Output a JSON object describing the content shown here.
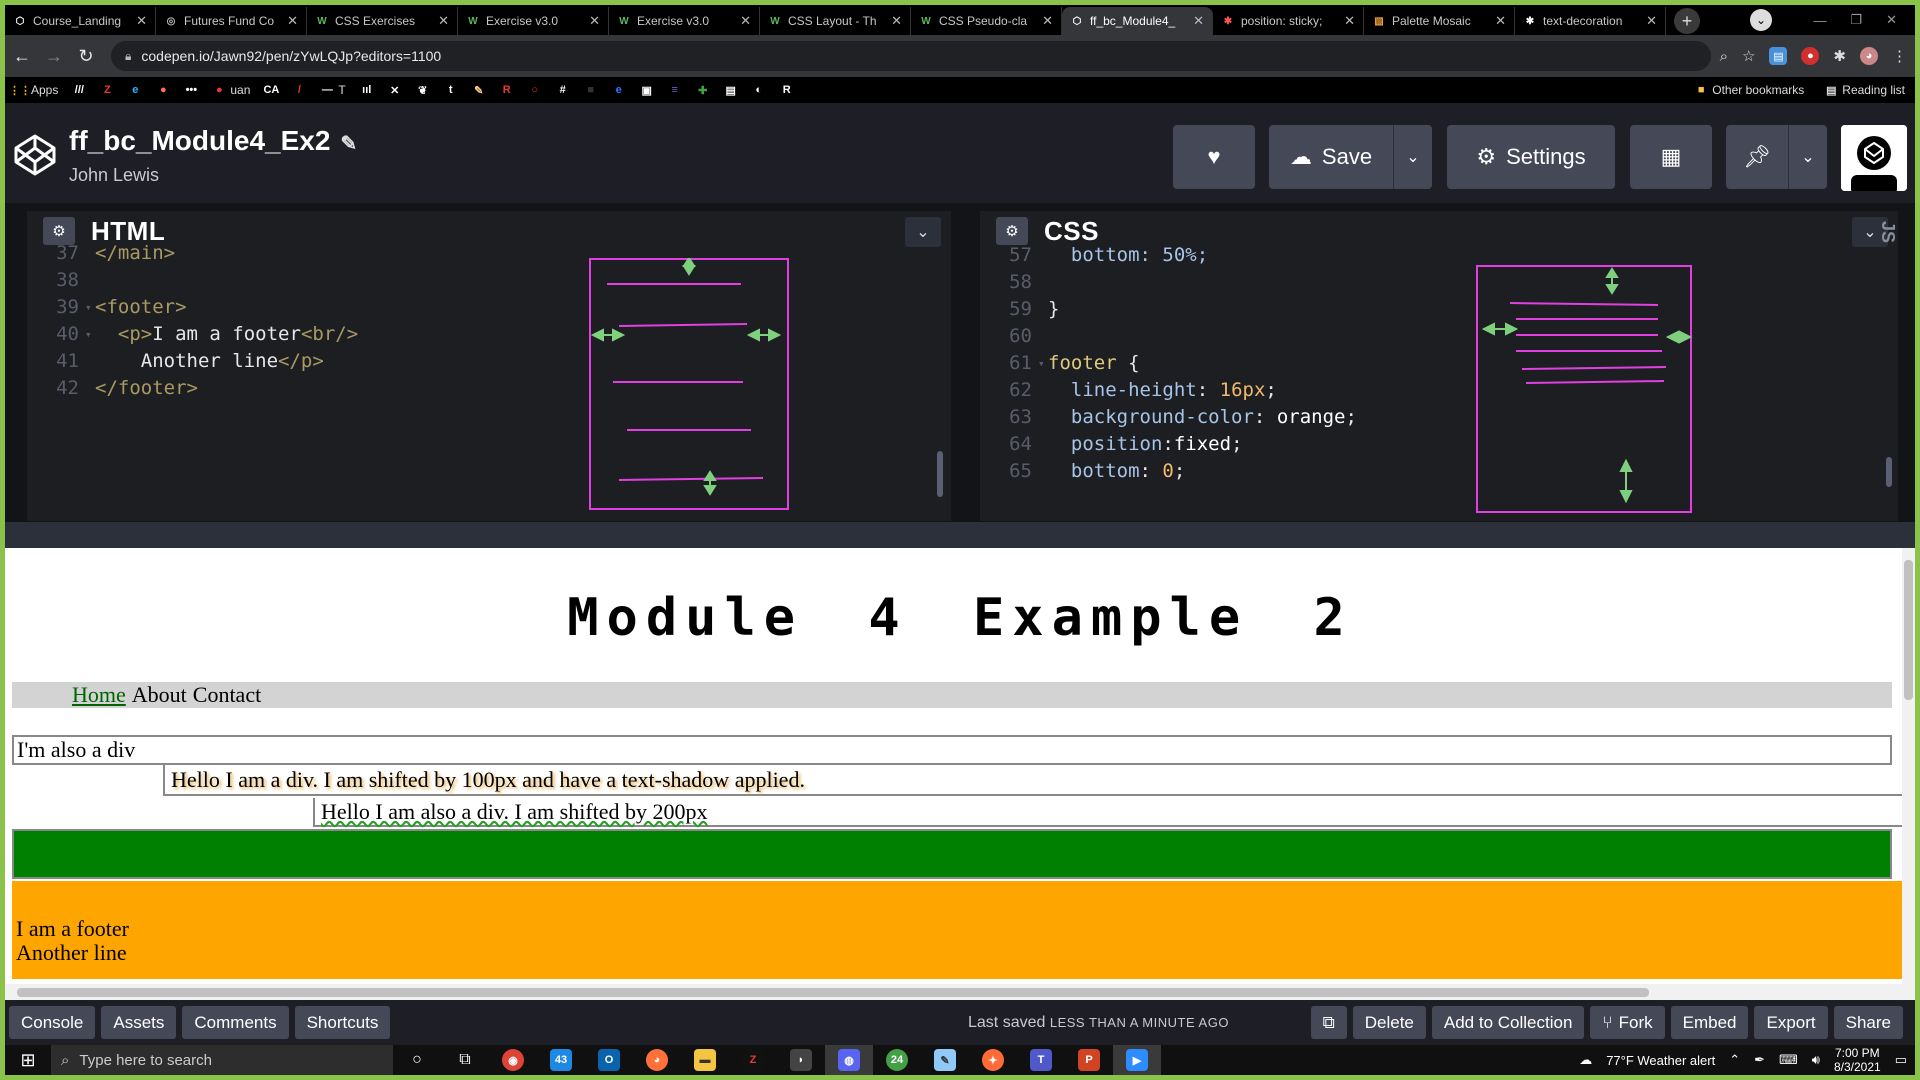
{
  "browser": {
    "tabs": [
      {
        "title": "Course_Landing",
        "favicon": "codepen-icon",
        "color": "#ffffff",
        "active": false
      },
      {
        "title": "Futures Fund Co",
        "favicon": "globe-icon",
        "color": "#bbbbbb",
        "active": false
      },
      {
        "title": "CSS Exercises",
        "favicon": "w-icon",
        "color": "#5cb85c",
        "active": false
      },
      {
        "title": "Exercise v3.0",
        "favicon": "w-icon",
        "color": "#5cb85c",
        "active": false
      },
      {
        "title": "Exercise v3.0",
        "favicon": "w-icon",
        "color": "#5cb85c",
        "active": false
      },
      {
        "title": "CSS Layout - Th",
        "favicon": "w-icon",
        "color": "#5cb85c",
        "active": false
      },
      {
        "title": "CSS Pseudo-cla",
        "favicon": "w-icon",
        "color": "#5cb85c",
        "active": false
      },
      {
        "title": "ff_bc_Module4_",
        "favicon": "codepen-icon",
        "color": "#ffffff",
        "active": true
      },
      {
        "title": "position: sticky;",
        "favicon": "mdn-icon",
        "color": "#ff5555",
        "active": false
      },
      {
        "title": "Palette Mosaic",
        "favicon": "palette-icon",
        "color": "#f0a030",
        "active": false
      },
      {
        "title": "text-decoration",
        "favicon": "mdn-icon",
        "color": "#ffffff",
        "active": false
      }
    ],
    "new_tab": "+",
    "url": "codepen.io/Jawn92/pen/zYwLQJp?editors=1100",
    "bookmarks": [
      {
        "label": "Apps",
        "icon": "apps-grid-icon",
        "color": "#f4b400"
      },
      {
        "label": "",
        "icon": "slash-icon",
        "color": "#ffffff",
        "text": "///"
      },
      {
        "label": "",
        "icon": "z-icon",
        "color": "#e53935",
        "text": "Z"
      },
      {
        "label": "",
        "icon": "e-icon",
        "color": "#29b6f6",
        "text": "e"
      },
      {
        "label": "",
        "icon": "orange-circle-icon",
        "color": "#ff7043",
        "text": "●"
      },
      {
        "label": "",
        "icon": "dots-icon",
        "color": "#ffffff",
        "text": "•••"
      },
      {
        "label": "uan",
        "icon": "red-circle-icon",
        "color": "#e53935",
        "text": "●"
      },
      {
        "label": "",
        "icon": "ca-icon",
        "color": "#ffffff",
        "text": "CA"
      },
      {
        "label": "",
        "icon": "slash-red-icon",
        "color": "#e53935",
        "text": "/"
      },
      {
        "label": "T",
        "icon": "dash-icon",
        "color": "#ffffff",
        "text": "—"
      },
      {
        "label": "",
        "icon": "bars-icon",
        "color": "#ffffff",
        "text": "ııl"
      },
      {
        "label": "",
        "icon": "x-box-icon",
        "color": "#ffffff",
        "text": "✕"
      },
      {
        "label": "",
        "icon": "leaf-icon",
        "color": "#ffffff",
        "text": "❦"
      },
      {
        "label": "",
        "icon": "t-icon",
        "color": "#ffffff",
        "text": "t"
      },
      {
        "label": "",
        "icon": "feather-icon",
        "color": "#ffcc80",
        "text": "✎"
      },
      {
        "label": "",
        "icon": "r-icon",
        "color": "#e53935",
        "text": "R"
      },
      {
        "label": "",
        "icon": "ring-icon",
        "color": "#e53935",
        "text": "○"
      },
      {
        "label": "",
        "icon": "hash-icon",
        "color": "#ffffff",
        "text": "#"
      },
      {
        "label": "",
        "icon": "dark-square-icon",
        "color": "#333333",
        "text": "■"
      },
      {
        "label": "",
        "icon": "e-blue-icon",
        "color": "#2979ff",
        "text": "e"
      },
      {
        "label": "",
        "icon": "box-icon",
        "color": "#ffffff",
        "text": "▣"
      },
      {
        "label": "",
        "icon": "list-icon",
        "color": "#7e57c2",
        "text": "≡"
      },
      {
        "label": "",
        "icon": "plus-icon",
        "color": "#43a047",
        "text": "✚"
      },
      {
        "label": "",
        "icon": "sheet-icon",
        "color": "#ffffff",
        "text": "▤"
      },
      {
        "label": "",
        "icon": "globe-icon",
        "color": "#ffffff",
        "text": "◐"
      },
      {
        "label": "",
        "icon": "r-box-icon",
        "color": "#ffffff",
        "text": "R"
      }
    ],
    "other_bookmarks": "Other bookmarks",
    "reading_list": "Reading list"
  },
  "codepen": {
    "title": "ff_bc_Module4_Ex2",
    "author": "John Lewis",
    "buttons": {
      "like": "♥",
      "save": "Save",
      "settings": "Settings"
    },
    "editors": {
      "html": {
        "name": "HTML",
        "lines": [
          {
            "n": "37",
            "fold": "",
            "indent": "",
            "parts": [
              {
                "c": "tg",
                "t": "</main>"
              }
            ]
          },
          {
            "n": "38",
            "fold": "",
            "indent": "",
            "parts": []
          },
          {
            "n": "39",
            "fold": "▾",
            "indent": "",
            "parts": [
              {
                "c": "tg",
                "t": "<footer>"
              }
            ]
          },
          {
            "n": "40",
            "fold": "▾",
            "indent": "  ",
            "parts": [
              {
                "c": "tg",
                "t": "<p>"
              },
              {
                "c": "tx",
                "t": "I am a footer"
              },
              {
                "c": "tg",
                "t": "<br/>"
              }
            ]
          },
          {
            "n": "41",
            "fold": "",
            "indent": "    ",
            "parts": [
              {
                "c": "tx",
                "t": "Another line"
              },
              {
                "c": "tg",
                "t": "</p>"
              }
            ]
          },
          {
            "n": "42",
            "fold": "",
            "indent": "",
            "parts": [
              {
                "c": "tg",
                "t": "</footer>"
              }
            ]
          }
        ]
      },
      "css": {
        "name": "CSS",
        "lines": [
          {
            "n": "57",
            "fold": "",
            "indent": "  ",
            "parts": [
              {
                "c": "prop",
                "t": "bottom: 50%;"
              }
            ]
          },
          {
            "n": "58",
            "fold": "",
            "indent": "",
            "parts": []
          },
          {
            "n": "59",
            "fold": "",
            "indent": "",
            "parts": [
              {
                "c": "punc",
                "t": "}"
              }
            ]
          },
          {
            "n": "60",
            "fold": "",
            "indent": "",
            "parts": []
          },
          {
            "n": "61",
            "fold": "▾",
            "indent": "",
            "parts": [
              {
                "c": "sel",
                "t": "footer"
              },
              {
                "c": "punc",
                "t": " {"
              }
            ]
          },
          {
            "n": "62",
            "fold": "",
            "indent": "  ",
            "parts": [
              {
                "c": "prop",
                "t": "line-height"
              },
              {
                "c": "punc",
                "t": ": "
              },
              {
                "c": "val",
                "t": "16px"
              },
              {
                "c": "punc",
                "t": ";"
              }
            ]
          },
          {
            "n": "63",
            "fold": "",
            "indent": "  ",
            "parts": [
              {
                "c": "prop",
                "t": "background-color"
              },
              {
                "c": "punc",
                "t": ": "
              },
              {
                "c": "valw",
                "t": "orange"
              },
              {
                "c": "punc",
                "t": ";"
              }
            ]
          },
          {
            "n": "64",
            "fold": "",
            "indent": "  ",
            "parts": [
              {
                "c": "prop",
                "t": "position"
              },
              {
                "c": "punc",
                "t": ":"
              },
              {
                "c": "valw",
                "t": "fixed"
              },
              {
                "c": "punc",
                "t": ";"
              }
            ]
          },
          {
            "n": "65",
            "fold": "",
            "indent": "  ",
            "parts": [
              {
                "c": "prop",
                "t": "bottom"
              },
              {
                "c": "punc",
                "t": ": "
              },
              {
                "c": "val",
                "t": "0"
              },
              {
                "c": "punc",
                "t": ";"
              }
            ]
          }
        ]
      },
      "js_label": "JS"
    },
    "bottom": {
      "left": [
        "Console",
        "Assets",
        "Comments",
        "Shortcuts"
      ],
      "saved_prefix": "Last saved",
      "saved_time": "LESS THAN A MINUTE AGO",
      "right": [
        "Delete",
        "Add to Collection",
        "Fork",
        "Embed",
        "Export",
        "Share"
      ]
    }
  },
  "preview": {
    "title": "Module 4 Example 2",
    "nav": {
      "home": "Home",
      "about": "About",
      "contact": "Contact"
    },
    "div1": "I'm also a div",
    "div2": "Hello I am a div. I am shifted by 100px and have a text-shadow applied.",
    "div3": "Hello I am also a div. I am shifted by 200px",
    "footer_line1": "I am a footer",
    "footer_line2": "Another line",
    "colors": {
      "nav_bg": "#d3d3d3",
      "green_box": "#008000",
      "footer_bg": "#ffa500",
      "link": "#006400"
    }
  },
  "taskbar": {
    "search_placeholder": "Type here to search",
    "weather": "77°F  Weather alert",
    "time": "7:00 PM",
    "date": "8/3/2021",
    "badges": {
      "vscode": "43",
      "chrome2": "24"
    }
  }
}
